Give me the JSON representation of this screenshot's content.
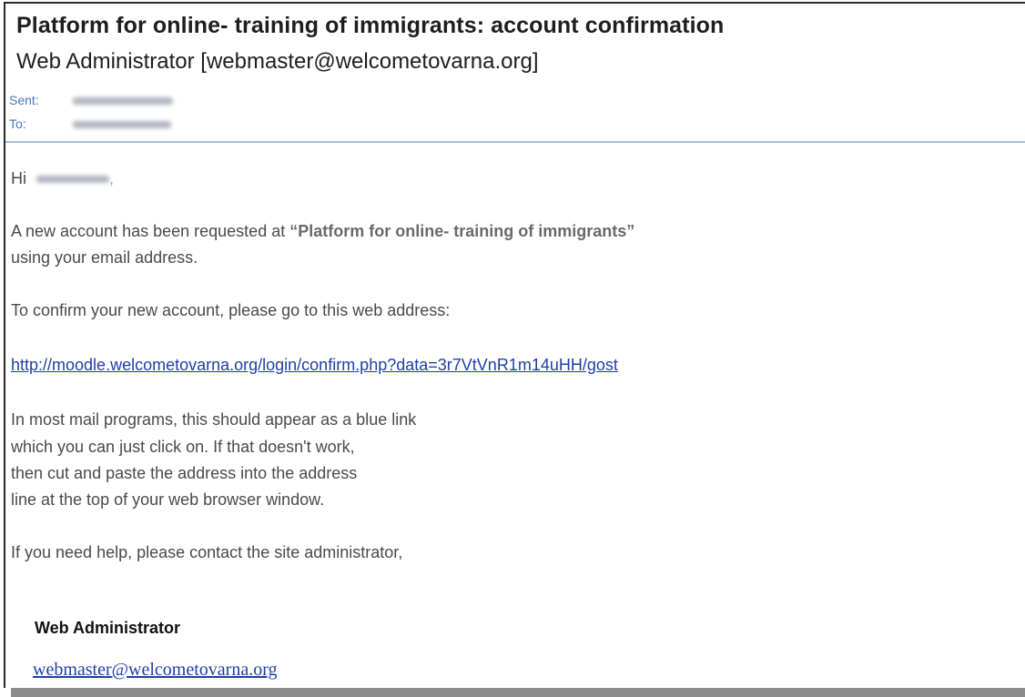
{
  "email": {
    "subject": "Platform for online- training of immigrants: account confirmation",
    "sender": "Web Administrator  [webmaster@welcometovarna.org]",
    "sent_label": "Sent:",
    "to_label": "To:"
  },
  "body": {
    "greeting": "Hi",
    "greeting_suffix": ",",
    "line1_prefix": "A new account has been requested at ",
    "platform_name": "“Platform for online- training of immigrants”",
    "line1_cont": "using your email address.",
    "line2": "To confirm your new account, please go to this web address:",
    "confirm_link": "http://moodle.welcometovarna.org/login/confirm.php?data=3r7VtVnR1m14uHH/gost",
    "para_lines": [
      "In most mail programs, this should appear as a blue link",
      "which you can just click on. If that doesn't work,",
      "then cut and paste the address into the address",
      "line at the top of your web browser window."
    ],
    "help_line": "If you need help, please contact the site administrator,"
  },
  "signature": {
    "name": "Web Administrator",
    "email": "webmaster@welcometovarna.org"
  }
}
